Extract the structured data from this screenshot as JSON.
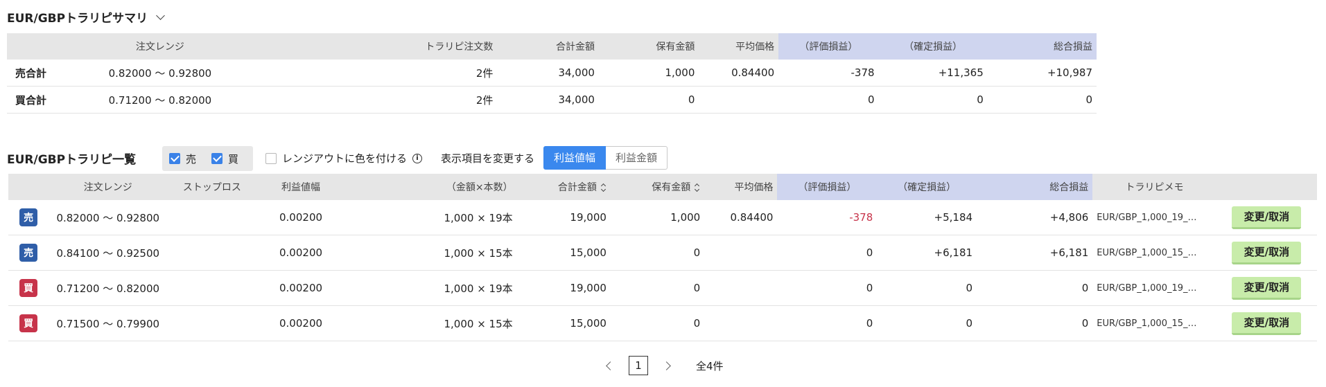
{
  "summary": {
    "title": "EUR/GBPトラリピサマリ",
    "headers": [
      "注文レンジ",
      "トラリピ注文数",
      "合計金額",
      "保有金額",
      "平均価格",
      "（評価損益）",
      "（確定損益）",
      "総合損益"
    ],
    "rows": [
      {
        "label": "売合計",
        "range": "0.82000 〜 0.92800",
        "count": "2件",
        "total": "34,000",
        "holding": "1,000",
        "avg": "0.84400",
        "unrealized": "-378",
        "realized": "+11,365",
        "pnl": "+10,987"
      },
      {
        "label": "買合計",
        "range": "0.71200 〜 0.82000",
        "count": "2件",
        "total": "34,000",
        "holding": "0",
        "avg": "",
        "unrealized": "0",
        "realized": "0",
        "pnl": "0"
      }
    ]
  },
  "list": {
    "title": "EUR/GBPトラリピ一覧",
    "filter_sell": "売",
    "filter_buy": "買",
    "range_color_option": "レンジアウトに色を付ける",
    "display_change_label": "表示項目を変更する",
    "seg_profit_width": "利益値幅",
    "seg_profit_amount": "利益金額",
    "headers": [
      "注文レンジ",
      "ストップロス",
      "利益値幅",
      "（金額×本数）",
      "合計金額",
      "保有金額",
      "平均価格",
      "（評価損益）",
      "（確定損益）",
      "総合損益",
      "トラリピメモ"
    ],
    "rows": [
      {
        "side": "売",
        "range": "0.82000 〜 0.92800",
        "stop": "",
        "width": "0.00200",
        "qty": "1,000 × 19本",
        "total": "19,000",
        "holding": "1,000",
        "avg": "0.84400",
        "unrealized": "-378",
        "realized": "+5,184",
        "pnl": "+4,806",
        "memo": "EUR/GBP_1,000_19_2…",
        "action": "変更/取消"
      },
      {
        "side": "売",
        "range": "0.84100 〜 0.92500",
        "stop": "",
        "width": "0.00200",
        "qty": "1,000 × 15本",
        "total": "15,000",
        "holding": "0",
        "avg": "",
        "unrealized": "0",
        "realized": "+6,181",
        "pnl": "+6,181",
        "memo": "EUR/GBP_1,000_15_2…",
        "action": "変更/取消"
      },
      {
        "side": "買",
        "range": "0.71200 〜 0.82000",
        "stop": "",
        "width": "0.00200",
        "qty": "1,000 × 19本",
        "total": "19,000",
        "holding": "0",
        "avg": "",
        "unrealized": "0",
        "realized": "0",
        "pnl": "0",
        "memo": "EUR/GBP_1,000_19_2…",
        "action": "変更/取消"
      },
      {
        "side": "買",
        "range": "0.71500 〜 0.79900",
        "stop": "",
        "width": "0.00200",
        "qty": "1,000 × 15本",
        "total": "15,000",
        "holding": "0",
        "avg": "",
        "unrealized": "0",
        "realized": "0",
        "pnl": "0",
        "memo": "EUR/GBP_1,000_15_2…",
        "action": "変更/取消"
      }
    ]
  },
  "pagination": {
    "current": "1",
    "total": "全4件"
  },
  "colors": {
    "accent": "#3a88ee",
    "sell": "#2f5ea8",
    "buy": "#c7334a",
    "edit_button": "#c8ecaa",
    "pl_header": "#cfd5ef"
  }
}
